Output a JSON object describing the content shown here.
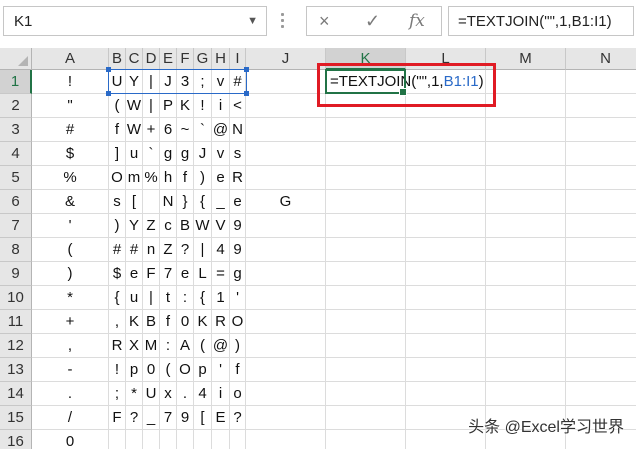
{
  "formula_bar": {
    "name_box": "K1",
    "formula": "=TEXTJOIN(\"\",1,B1:I1)",
    "cancel_icon": "×",
    "enter_icon": "✓",
    "fx_icon": "fx"
  },
  "columns": [
    "A",
    "B",
    "C",
    "D",
    "E",
    "F",
    "G",
    "H",
    "I",
    "J",
    "K",
    "L",
    "M",
    "N"
  ],
  "rows": [
    "1",
    "2",
    "3",
    "4",
    "5",
    "6",
    "7",
    "8",
    "9",
    "10",
    "11",
    "12",
    "13",
    "14",
    "15",
    "16"
  ],
  "cells": [
    [
      "!",
      "U",
      "Y",
      "|",
      "J",
      "3",
      ";",
      "v",
      "#"
    ],
    [
      "\"",
      "(",
      "W",
      "|",
      "P",
      "K",
      "!",
      "i",
      "<"
    ],
    [
      "#",
      "f",
      "W",
      "+",
      "6",
      "~",
      "`",
      "@",
      "N"
    ],
    [
      "$",
      "]",
      "u",
      "`",
      "g",
      "g",
      "J",
      "v",
      "s"
    ],
    [
      "%",
      "O",
      "m",
      "%",
      "h",
      "f",
      ")",
      "e",
      "R"
    ],
    [
      "&",
      "s",
      "[",
      "",
      "N",
      "}",
      "{",
      "_",
      "e",
      "G"
    ],
    [
      "'",
      ")",
      "Y",
      "Z",
      "c",
      "B",
      "W",
      "V",
      "9"
    ],
    [
      "(",
      "#",
      "#",
      "n",
      "Z",
      "?",
      "|",
      "4",
      "9"
    ],
    [
      ")",
      "$",
      "e",
      "F",
      "7",
      "e",
      "L",
      "=",
      "g"
    ],
    [
      "*",
      "{",
      "u",
      "|",
      "t",
      ":",
      "{",
      "1",
      "'"
    ],
    [
      "+",
      ",",
      "K",
      "B",
      "f",
      "0",
      "K",
      "R",
      "O"
    ],
    [
      ",",
      "R",
      "X",
      "M",
      ":",
      "A",
      "(",
      "@",
      ")"
    ],
    [
      "-",
      "!",
      "p",
      "0",
      "(",
      "O",
      "p",
      "'",
      "f"
    ],
    [
      ".",
      ";",
      "*",
      "U",
      "x",
      ".",
      "4",
      "i",
      "o"
    ],
    [
      "/",
      "F",
      "?",
      "_",
      "7",
      "9",
      "[",
      "E",
      "?"
    ],
    [
      "0",
      "",
      "",
      "",
      "",
      "",
      "",
      "",
      ""
    ]
  ],
  "k1_formula": {
    "prefix": "=TEXTJOIN(\"\",1,",
    "range": "B1:I1",
    "suffix": ")"
  },
  "watermark": "头条 @Excel学习世界",
  "colors": {
    "accent": "#217346",
    "reference": "#2a6ac8",
    "highlight": "#e01b24"
  }
}
